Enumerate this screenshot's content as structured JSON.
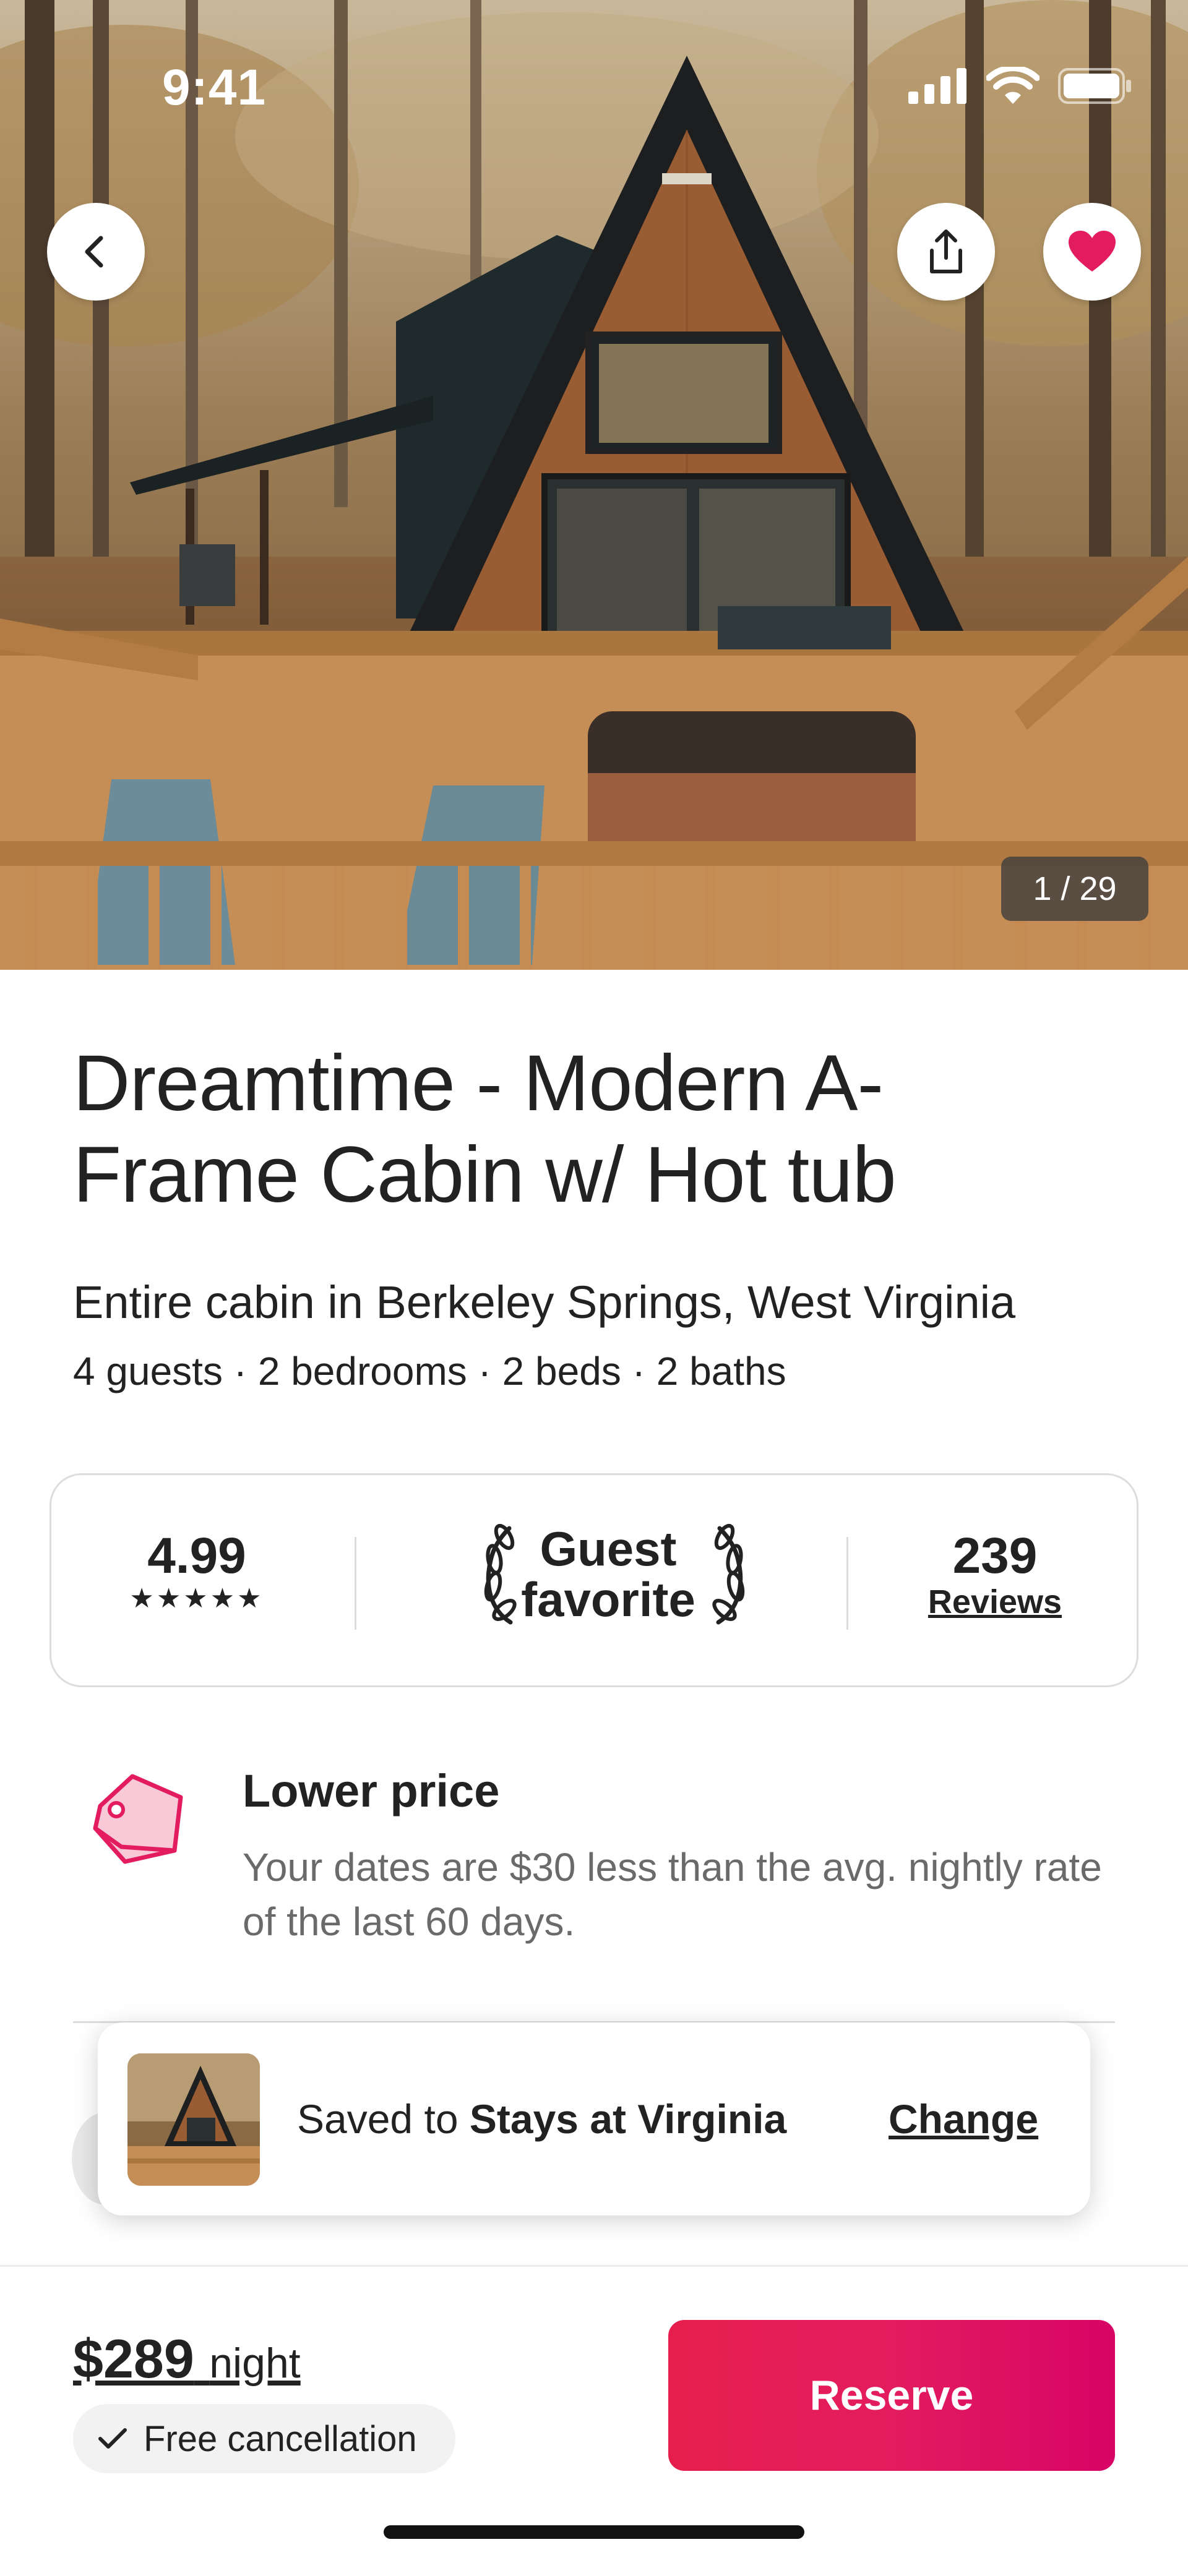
{
  "status_bar": {
    "time": "9:41"
  },
  "hero": {
    "photo_counter": "1 / 29"
  },
  "listing": {
    "title": "Dreamtime - Modern A-Frame Cabin w/ Hot tub",
    "subtitle": "Entire cabin in Berkeley Springs, West Virginia",
    "details": "4 guests · 2 bedrooms · 2 beds · 2 baths"
  },
  "rating_card": {
    "score": "4.99",
    "stars": "★★★★★",
    "star_count": 5,
    "badge_line1": "Guest",
    "badge_line2": "favorite",
    "review_count": "239",
    "reviews_label": "Reviews"
  },
  "lower_price": {
    "title": "Lower price",
    "description": "Your dates are $30 less than the avg. nightly rate of the last 60 days."
  },
  "toast": {
    "prefix": "Saved to ",
    "wishlist_name": "Stays at Virginia",
    "action_label": "Change"
  },
  "footer": {
    "price": "$289",
    "price_unit": "night",
    "free_cancellation": "Free cancellation",
    "reserve_label": "Reserve"
  },
  "colors": {
    "brand": "#E31C5F",
    "heart": "#E31C5F",
    "text_primary": "#222222",
    "text_secondary": "#6A6A6A",
    "border": "#DDDDDD",
    "chip_bg": "#F2F2F2"
  },
  "icons": {
    "back": "chevron-left-icon",
    "share": "share-icon",
    "favorite": "heart-icon",
    "laurel": "laurel-icon",
    "price_tag": "price-tag-icon",
    "check": "check-icon"
  }
}
